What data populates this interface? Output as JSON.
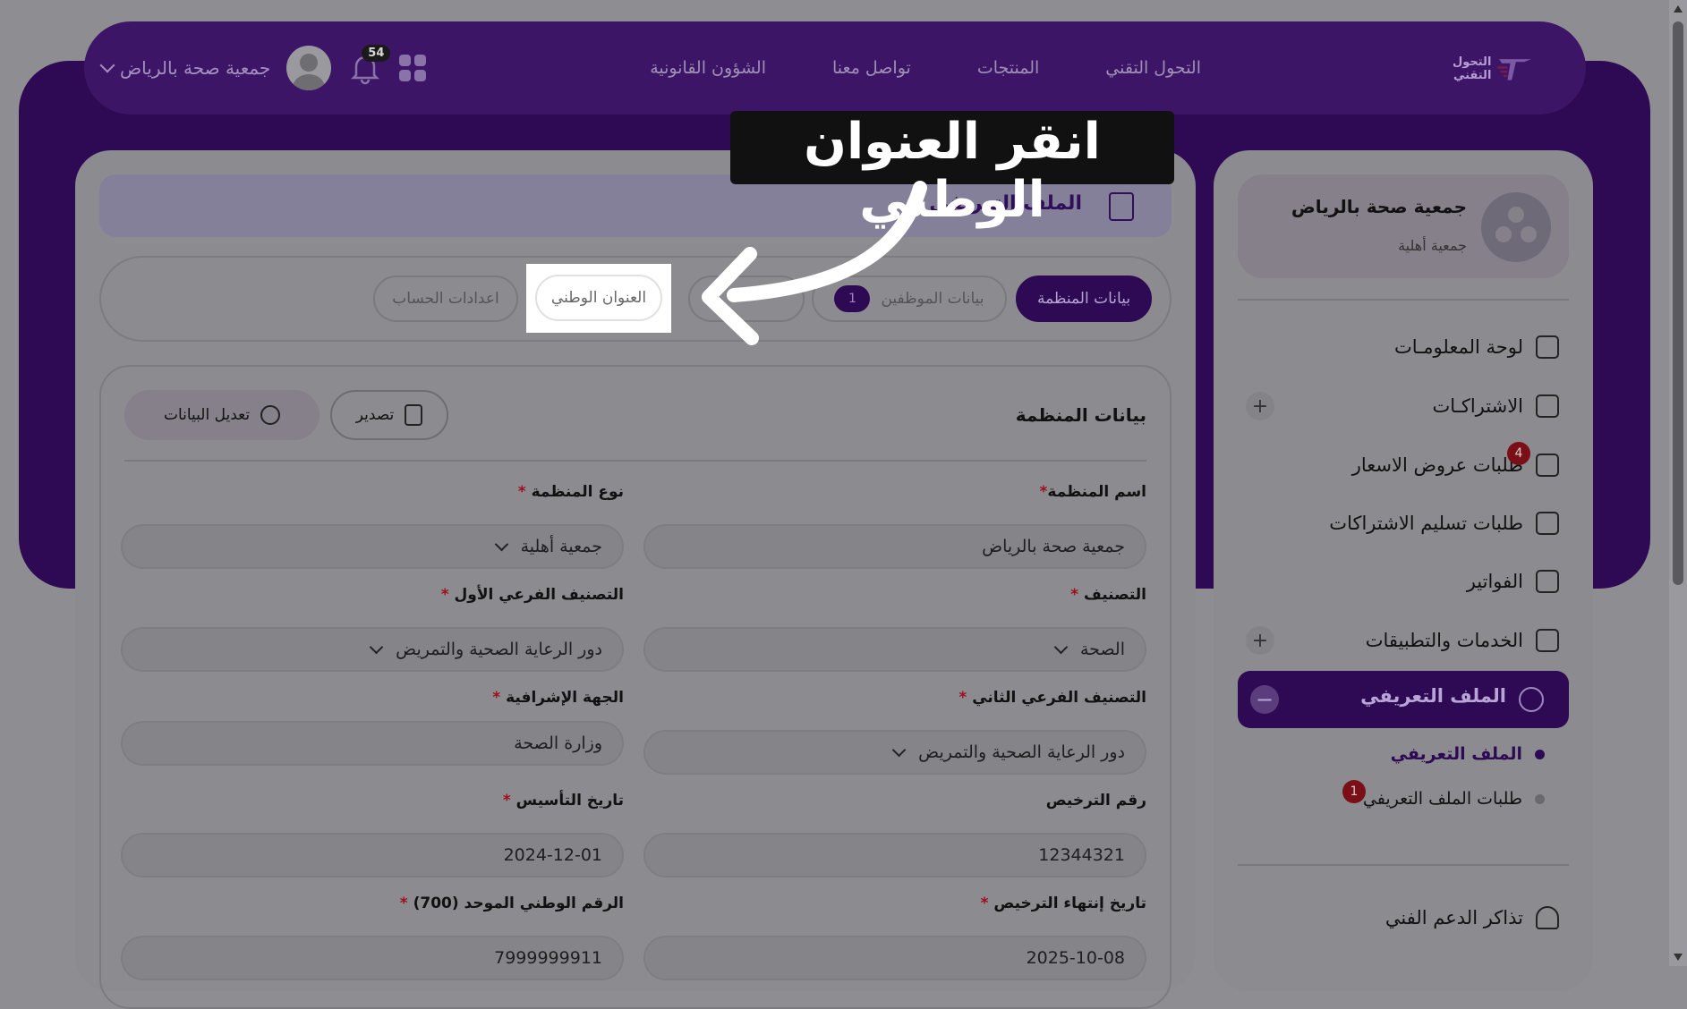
{
  "topbar": {
    "logo_text": "التحول التقني",
    "nav": [
      "التحول التقني",
      "المنتجات",
      "تواصل معنا",
      "الشؤون القانونية"
    ],
    "notifications_count": "54",
    "org_select": "جمعية صحة بالرياض"
  },
  "header": {
    "title": "الملف التعريفي"
  },
  "tabs": {
    "org_data": "بيانات المنظمة",
    "employees": "بيانات الموظفين",
    "employees_count": "1",
    "national_address": "العنوان الوطني",
    "account_settings": "اعدادات الحساب"
  },
  "form": {
    "section_title": "بيانات المنظمة",
    "export_label": "تصدير",
    "edit_label": "تعديل البيانات",
    "fields": {
      "org_name": {
        "label": "اسم المنظمة",
        "value": "جمعية صحة بالرياض"
      },
      "org_type": {
        "label": "نوع المنظمة",
        "value": "جمعية أهلية"
      },
      "category": {
        "label": "التصنيف",
        "value": "الصحة"
      },
      "sub_category_1": {
        "label": "التصنيف الفرعي الأول",
        "value": "دور الرعاية الصحية والتمريض"
      },
      "sub_category_2": {
        "label": "التصنيف الفرعي الثاني",
        "value": "دور الرعاية الصحية والتمريض"
      },
      "supervisor": {
        "label": "الجهة الإشرافية",
        "value": "وزارة الصحة"
      },
      "license_no": {
        "label": "رقم الترخيص",
        "value": "12344321"
      },
      "founded": {
        "label": "تاريخ التأسيس",
        "value": "2024-12-01"
      },
      "license_end": {
        "label": "تاريخ إنتهاء الترخيص",
        "value": "2025-10-08"
      },
      "unified_no": {
        "label": "الرقم الوطني الموحد (700)",
        "value": "7999999911"
      }
    }
  },
  "sidebar": {
    "org_name": "جمعية صحة بالرياض",
    "org_type": "جمعية أهلية",
    "items": {
      "dashboard": "لوحة المعلومـات",
      "subscriptions": "الاشتراكـات",
      "quotes": "طلبات عروض الاسعار",
      "quotes_badge": "4",
      "deliveries": "طلبات تسليم الاشتراكات",
      "invoices": "الفواتير",
      "services": "الخدمات والتطبيقات",
      "profile": "الملف التعريفي",
      "profile_sub": "الملف التعريفي",
      "profile_requests": "طلبات الملف التعريفي",
      "profile_requests_badge": "1",
      "support": "تذاكر الدعم الفني"
    }
  },
  "callout": {
    "text": "انقر العنوان الوطني"
  },
  "colors": {
    "brand": "#2e0a55",
    "required": "#a10d1d"
  }
}
